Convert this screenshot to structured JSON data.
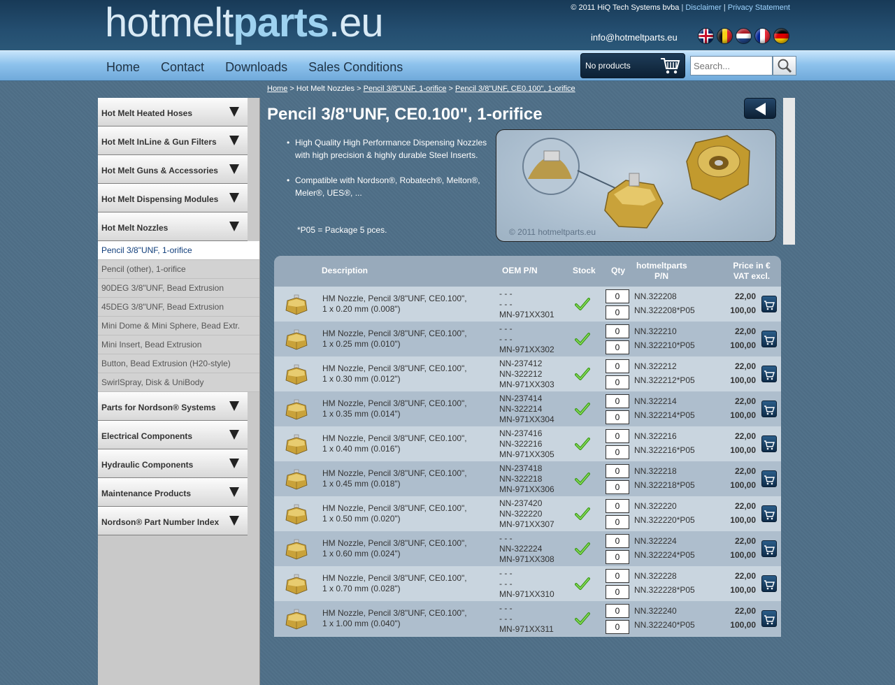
{
  "header": {
    "logo": {
      "part1": "hotmelt",
      "part2": "parts",
      "part3": ".eu"
    },
    "copyright": "© 2011 HiQ Tech Systems bvba",
    "disclaimer_link": "Disclaimer",
    "privacy_link": "Privacy Statement",
    "separator": "|",
    "email": "info@hotmeltparts.eu",
    "languages": [
      "en",
      "be",
      "nl",
      "fr",
      "de"
    ]
  },
  "nav": {
    "items": [
      "Home",
      "Contact",
      "Downloads",
      "Sales Conditions"
    ],
    "cart_text": "No products",
    "search_placeholder": "Search..."
  },
  "sidebar": {
    "categories_top": [
      "Hot Melt Heated Hoses",
      "Hot Melt InLine & Gun Filters",
      "Hot Melt Guns & Accessories",
      "Hot Melt Dispensing Modules",
      "Hot Melt Nozzles"
    ],
    "subitems": [
      "Pencil 3/8\"UNF, 1-orifice",
      "Pencil (other), 1-orifice",
      "90DEG 3/8\"UNF, Bead Extrusion",
      "45DEG 3/8\"UNF, Bead Extrusion",
      "Mini Dome & Mini Sphere, Bead Extr.",
      "Mini Insert, Bead Extrusion",
      "Button, Bead Extrusion (H20-style)",
      "SwirlSpray, Disk & UniBody"
    ],
    "categories_bottom": [
      "Parts for Nordson® Systems",
      "Electrical Components",
      "Hydraulic Components",
      "Maintenance Products",
      "Nordson® Part Number Index"
    ]
  },
  "breadcrumb": {
    "home": "Home",
    "sep": ">",
    "category": "Hot Melt Nozzles",
    "sub": "Pencil 3/8\"UNF, 1-orifice",
    "current": "Pencil 3/8\"UNF, CE0.100\", 1-orifice"
  },
  "page_title": "Pencil 3/8\"UNF, CE0.100\", 1-orifice",
  "bullets": [
    "High Quality High Performance Dispensing Nozzles with high precision & highly durable Steel Inserts.",
    "Compatible with Nordson®, Robatech®, Melton®, Meler®, UES®, ..."
  ],
  "package_note": "*P05 = Package 5 pces.",
  "image_copyright": "© 2011 hotmeltparts.eu",
  "table": {
    "headers": {
      "description": "Description",
      "oem": "OEM P/N",
      "stock": "Stock",
      "qty": "Qty",
      "pn_line1": "hotmeltparts",
      "pn_line2": "P/N",
      "price_line1": "Price in €",
      "price_line2": "VAT excl."
    },
    "rows": [
      {
        "desc1": "HM Nozzle, Pencil 3/8\"UNF, CE0.100\",",
        "desc2": "1 x 0.20 mm (0.008\")",
        "oem1": "- - -",
        "oem2": "- - -",
        "oem3": "MN-971XX301",
        "q1": "0",
        "q2": "0",
        "pn1": "NN.322208",
        "pn2": "NN.322208*P05",
        "price1": "22,00",
        "price2": "100,00"
      },
      {
        "desc1": "HM Nozzle, Pencil 3/8\"UNF, CE0.100\",",
        "desc2": "1 x 0.25 mm (0.010\")",
        "oem1": "- - -",
        "oem2": "- - -",
        "oem3": "MN-971XX302",
        "q1": "0",
        "q2": "0",
        "pn1": "NN.322210",
        "pn2": "NN.322210*P05",
        "price1": "22,00",
        "price2": "100,00"
      },
      {
        "desc1": "HM Nozzle, Pencil 3/8\"UNF, CE0.100\",",
        "desc2": "1 x 0.30 mm (0.012\")",
        "oem1": "NN-237412",
        "oem2": "NN-322212",
        "oem3": "MN-971XX303",
        "q1": "0",
        "q2": "0",
        "pn1": "NN.322212",
        "pn2": "NN.322212*P05",
        "price1": "22,00",
        "price2": "100,00"
      },
      {
        "desc1": "HM Nozzle, Pencil 3/8\"UNF, CE0.100\",",
        "desc2": "1 x 0.35 mm (0.014\")",
        "oem1": "NN-237414",
        "oem2": "NN-322214",
        "oem3": "MN-971XX304",
        "q1": "0",
        "q2": "0",
        "pn1": "NN.322214",
        "pn2": "NN.322214*P05",
        "price1": "22,00",
        "price2": "100,00"
      },
      {
        "desc1": "HM Nozzle, Pencil 3/8\"UNF, CE0.100\",",
        "desc2": "1 x 0.40 mm (0.016\")",
        "oem1": "NN-237416",
        "oem2": "NN-322216",
        "oem3": "MN-971XX305",
        "q1": "0",
        "q2": "0",
        "pn1": "NN.322216",
        "pn2": "NN.322216*P05",
        "price1": "22,00",
        "price2": "100,00"
      },
      {
        "desc1": "HM Nozzle, Pencil 3/8\"UNF, CE0.100\",",
        "desc2": "1 x 0.45 mm (0.018\")",
        "oem1": "NN-237418",
        "oem2": "NN-322218",
        "oem3": "MN-971XX306",
        "q1": "0",
        "q2": "0",
        "pn1": "NN.322218",
        "pn2": "NN.322218*P05",
        "price1": "22,00",
        "price2": "100,00"
      },
      {
        "desc1": "HM Nozzle, Pencil 3/8\"UNF, CE0.100\",",
        "desc2": "1 x 0.50 mm (0.020\")",
        "oem1": "NN-237420",
        "oem2": "NN-322220",
        "oem3": "MN-971XX307",
        "q1": "0",
        "q2": "0",
        "pn1": "NN.322220",
        "pn2": "NN.322220*P05",
        "price1": "22,00",
        "price2": "100,00"
      },
      {
        "desc1": "HM Nozzle, Pencil 3/8\"UNF, CE0.100\",",
        "desc2": "1 x 0.60 mm (0.024\")",
        "oem1": "- - -",
        "oem2": "NN-322224",
        "oem3": "MN-971XX308",
        "q1": "0",
        "q2": "0",
        "pn1": "NN.322224",
        "pn2": "NN.322224*P05",
        "price1": "22,00",
        "price2": "100,00"
      },
      {
        "desc1": "HM Nozzle, Pencil 3/8\"UNF, CE0.100\",",
        "desc2": "1 x 0.70 mm (0.028\")",
        "oem1": "- - -",
        "oem2": "- - -",
        "oem3": "MN-971XX310",
        "q1": "0",
        "q2": "0",
        "pn1": "NN.322228",
        "pn2": "NN.322228*P05",
        "price1": "22,00",
        "price2": "100,00"
      },
      {
        "desc1": "HM Nozzle, Pencil 3/8\"UNF, CE0.100\",",
        "desc2": "1 x 1.00 mm (0.040\")",
        "oem1": "- - -",
        "oem2": "- - -",
        "oem3": "MN-971XX311",
        "q1": "0",
        "q2": "0",
        "pn1": "NN.322240",
        "pn2": "NN.322240*P05",
        "price1": "22,00",
        "price2": "100,00"
      }
    ]
  }
}
